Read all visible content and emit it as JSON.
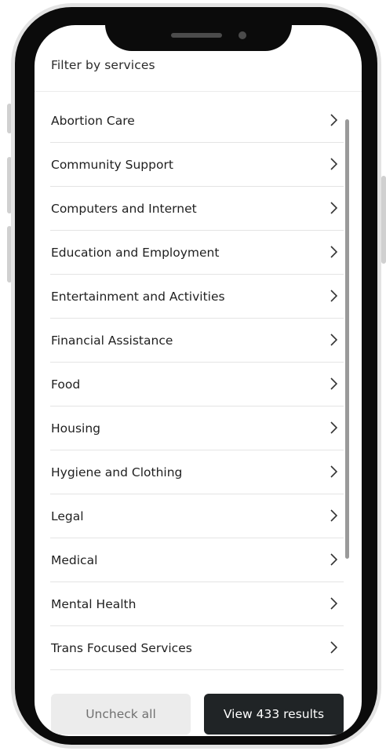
{
  "header": {
    "title": "Filter by services"
  },
  "services": [
    {
      "label": "Abortion Care"
    },
    {
      "label": "Community Support"
    },
    {
      "label": "Computers and Internet"
    },
    {
      "label": "Education and Employment"
    },
    {
      "label": "Entertainment and Activities"
    },
    {
      "label": "Financial Assistance"
    },
    {
      "label": "Food"
    },
    {
      "label": "Housing"
    },
    {
      "label": "Hygiene and Clothing"
    },
    {
      "label": "Legal"
    },
    {
      "label": "Medical"
    },
    {
      "label": "Mental Health"
    },
    {
      "label": "Trans Focused Services"
    }
  ],
  "footer": {
    "uncheck_label": "Uncheck all",
    "view_label": "View 433 results"
  },
  "icons": {
    "row_icon": "chevron-right-icon"
  },
  "colors": {
    "primary_button": "#202426",
    "secondary_button": "#ececec"
  }
}
